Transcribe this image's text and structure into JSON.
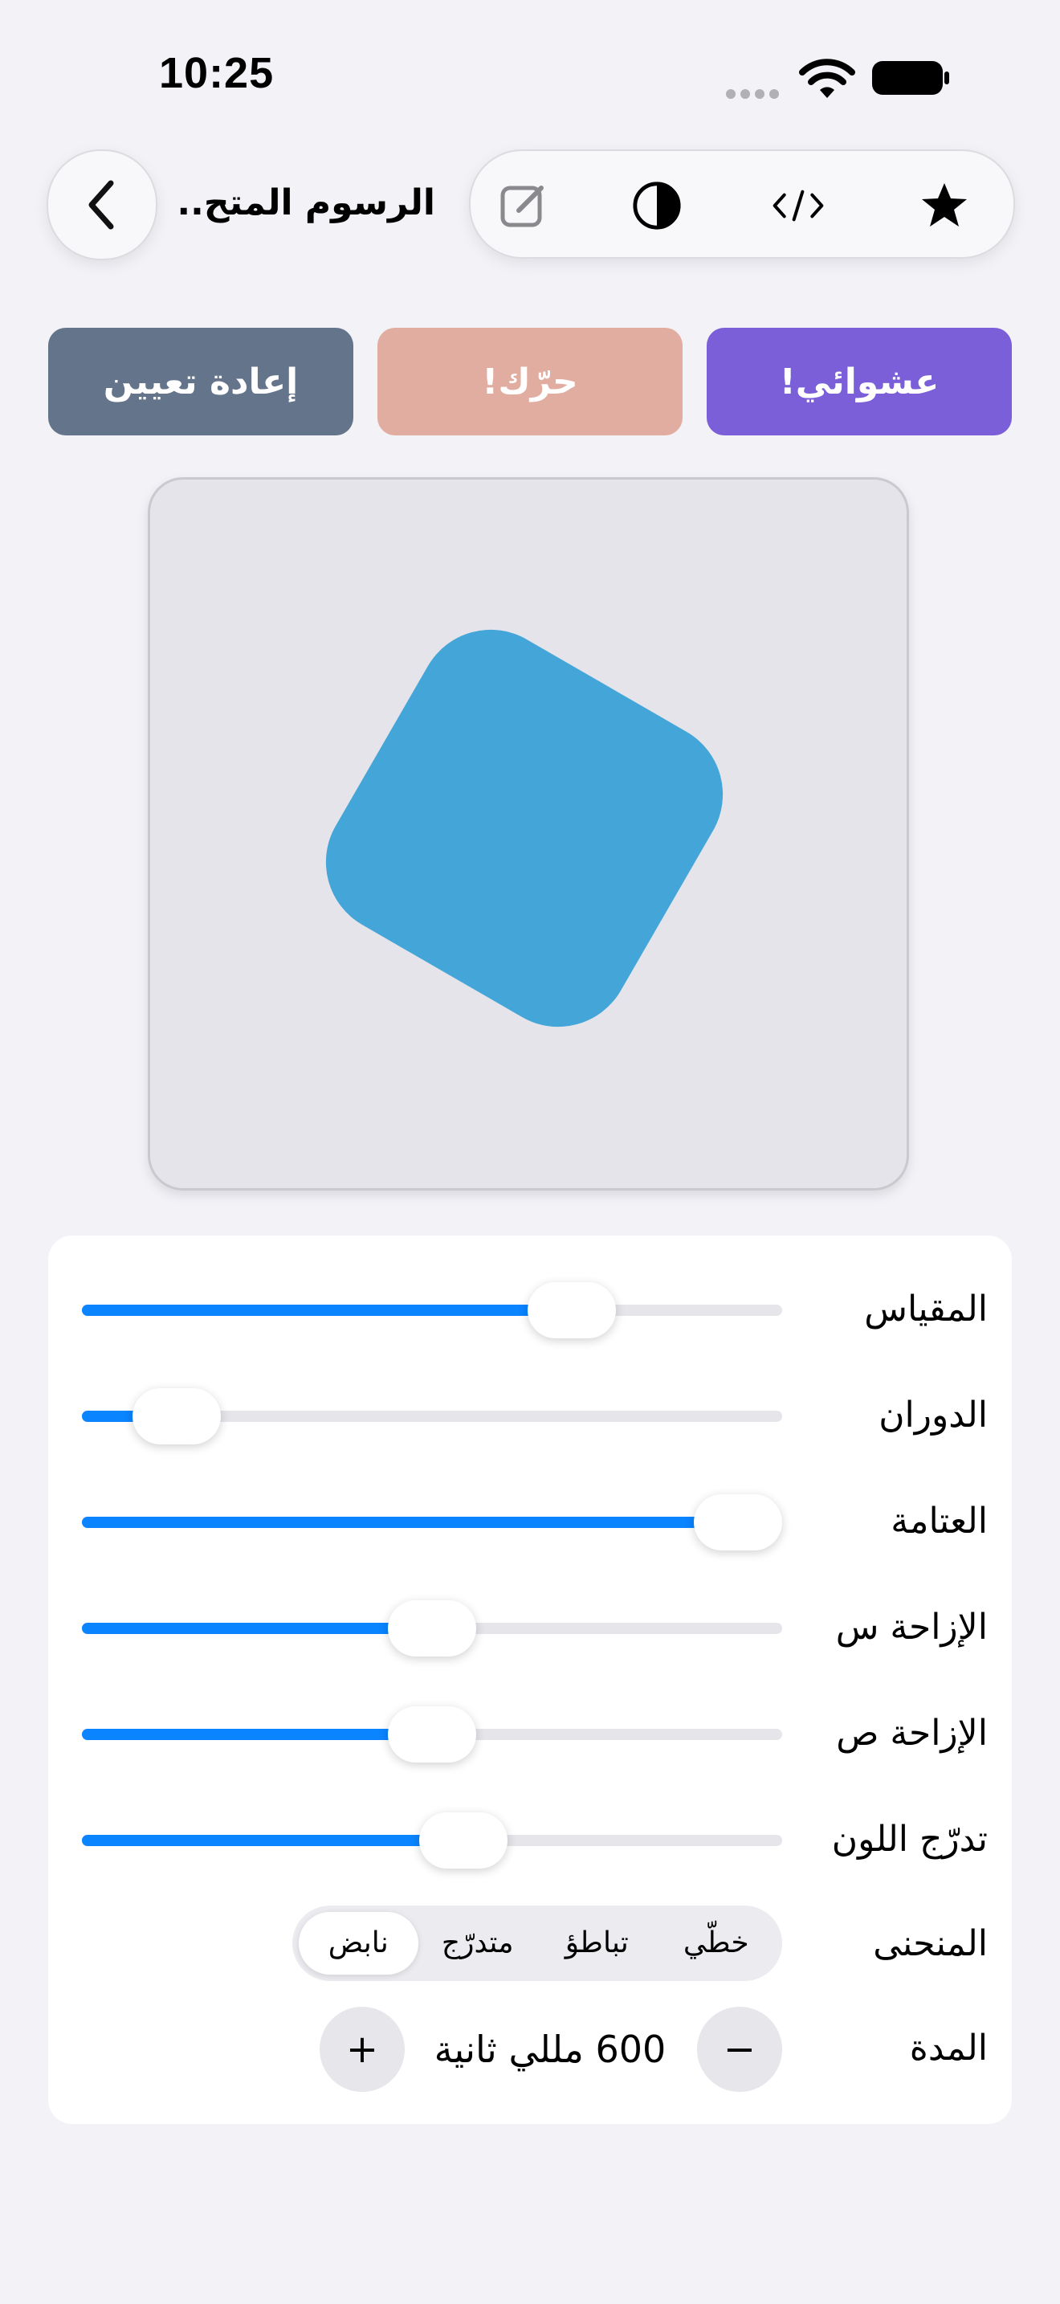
{
  "status": {
    "time": "10:25"
  },
  "nav": {
    "title": "الرسوم المتح...",
    "tools": [
      "star-icon",
      "code-icon",
      "contrast-icon",
      "edit-icon"
    ]
  },
  "actions": {
    "random": "عشوائي!",
    "animate": "حرّك!",
    "reset": "إعادة تعيين"
  },
  "colors": {
    "accent": "#0a84ff",
    "random_btn": "#7b5fd8",
    "animate_btn": "#e2ada1",
    "reset_btn": "#64748b",
    "shape": "#44a6d8"
  },
  "controls": {
    "sliders": [
      {
        "label": "المقياس",
        "value": 0.7
      },
      {
        "label": "الدوران",
        "value": 0.135
      },
      {
        "label": "العتامة",
        "value": 1.0
      },
      {
        "label": "الإزاحة س",
        "value": 0.5
      },
      {
        "label": "الإزاحة ص",
        "value": 0.5
      },
      {
        "label": "تدرّج اللون",
        "value": 0.55
      }
    ],
    "curve": {
      "label": "المنحنى",
      "options": [
        "خطّي",
        "تباطؤ",
        "متدرّج",
        "نابض"
      ],
      "selected": "نابض"
    },
    "duration": {
      "label": "المدة",
      "value": "600 مللي ثانية",
      "minus": "−",
      "plus": "+"
    }
  }
}
